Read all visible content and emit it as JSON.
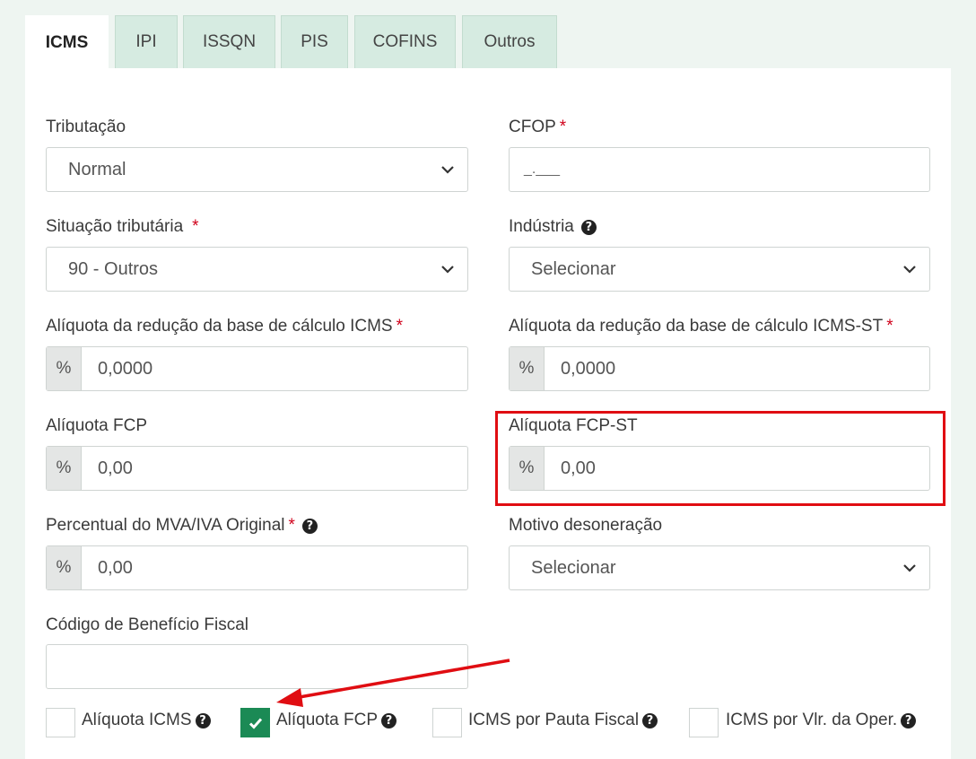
{
  "tabs": [
    {
      "label": "ICMS",
      "active": true
    },
    {
      "label": "IPI"
    },
    {
      "label": "ISSQN"
    },
    {
      "label": "PIS"
    },
    {
      "label": "COFINS"
    },
    {
      "label": "Outros"
    }
  ],
  "form": {
    "tributacao": {
      "label": "Tributação",
      "value": "Normal"
    },
    "cfop": {
      "label": "CFOP",
      "required": "*",
      "value": "_.___"
    },
    "situacao": {
      "label": "Situação tributária",
      "required": "*",
      "value": "90 - Outros"
    },
    "industria": {
      "label": "Indústria",
      "value": "Selecionar"
    },
    "aliq_red_icms": {
      "label": "Alíquota da redução da base de cálculo ICMS",
      "required": "*",
      "addon": "%",
      "value": "0,0000"
    },
    "aliq_red_icms_st": {
      "label": "Alíquota da redução da base de cálculo ICMS-ST",
      "required": "*",
      "addon": "%",
      "value": "0,0000"
    },
    "aliq_fcp": {
      "label": "Alíquota FCP",
      "addon": "%",
      "value": "0,00"
    },
    "aliq_fcp_st": {
      "label": "Alíquota FCP-ST",
      "addon": "%",
      "value": "0,00"
    },
    "mva": {
      "label": "Percentual do MVA/IVA Original",
      "required": "*",
      "addon": "%",
      "value": "0,00"
    },
    "motivo": {
      "label": "Motivo desoneração",
      "value": "Selecionar"
    },
    "beneficio": {
      "label": "Código de Benefício Fiscal",
      "value": ""
    }
  },
  "checkboxes": [
    {
      "label": "Alíquota ICMS",
      "checked": false
    },
    {
      "label": "Alíquota FCP",
      "checked": true
    },
    {
      "label": "ICMS por Pauta Fiscal",
      "checked": false
    },
    {
      "label": "ICMS por Vlr. da Oper.",
      "checked": false
    }
  ],
  "colors": {
    "tab_inactive": "#d6ebe1",
    "checked": "#1b8a55",
    "highlight": "#e00d12",
    "required": "#d0021b"
  },
  "icons": {
    "help": "question-circle-icon",
    "check": "check-icon",
    "chevron": "chevron-down-icon"
  }
}
